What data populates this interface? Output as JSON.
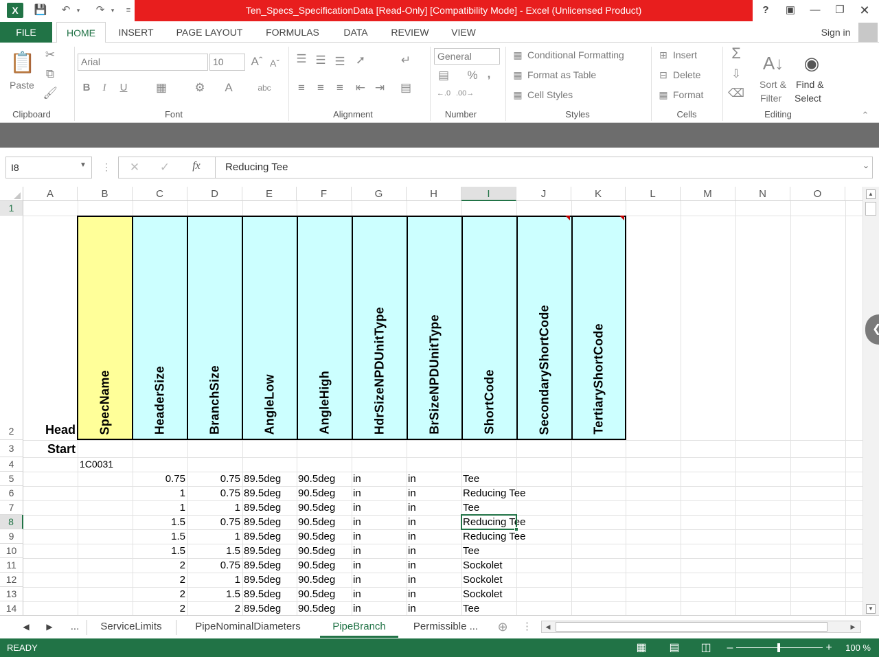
{
  "app": {
    "title": "Ten_Specs_SpecificationData  [Read-Only]  [Compatibility Mode] -  Excel (Unlicensed Product)",
    "sign_in": "Sign in",
    "help": "?"
  },
  "tabs": [
    "FILE",
    "HOME",
    "INSERT",
    "PAGE LAYOUT",
    "FORMULAS",
    "DATA",
    "REVIEW",
    "VIEW"
  ],
  "ribbon": {
    "clipboard": {
      "paste": "Paste",
      "label": "Clipboard"
    },
    "font": {
      "name": "Arial",
      "size": "10",
      "label": "Font",
      "bold": "B",
      "italic": "I",
      "underline": "U"
    },
    "alignment": {
      "label": "Alignment"
    },
    "number": {
      "format": "General",
      "percent": "%",
      "comma": ",",
      "label": "Number"
    },
    "styles": {
      "conditional": "Conditional Formatting",
      "table": "Format as Table",
      "cell": "Cell Styles",
      "label": "Styles"
    },
    "cells": {
      "insert": "Insert",
      "delete": "Delete",
      "format": "Format",
      "label": "Cells"
    },
    "editing": {
      "sort1": "Sort &",
      "sort2": "Filter",
      "find1": "Find &",
      "find2": "Select",
      "label": "Editing"
    }
  },
  "formula_bar": {
    "name_box": "I8",
    "fx": "fx",
    "value": "Reducing Tee"
  },
  "columns": [
    "A",
    "B",
    "C",
    "D",
    "E",
    "F",
    "G",
    "H",
    "I",
    "J",
    "K",
    "L",
    "M",
    "N",
    "O"
  ],
  "rows": [
    "1",
    "2",
    "3",
    "4",
    "5",
    "6",
    "7",
    "8",
    "9",
    "10",
    "11",
    "12",
    "13",
    "14"
  ],
  "headers": [
    "SpecName",
    "HeaderSize",
    "BranchSize",
    "AngleLow",
    "AngleHigh",
    "HdrSizeNPDUnitType",
    "BrSizeNPDUnitType",
    "ShortCode",
    "SecondaryShortCode",
    "TertiaryShortCode"
  ],
  "a_labels": {
    "row2": "Head",
    "row3": "Start"
  },
  "spec_value": "1C0031",
  "data_rows": [
    {
      "c": "0.75",
      "d": "0.75",
      "e": "89.5deg",
      "f": "90.5deg",
      "g": "in",
      "h": "in",
      "i": "Tee"
    },
    {
      "c": "1",
      "d": "0.75",
      "e": "89.5deg",
      "f": "90.5deg",
      "g": "in",
      "h": "in",
      "i": "Reducing Tee"
    },
    {
      "c": "1",
      "d": "1",
      "e": "89.5deg",
      "f": "90.5deg",
      "g": "in",
      "h": "in",
      "i": "Tee"
    },
    {
      "c": "1.5",
      "d": "0.75",
      "e": "89.5deg",
      "f": "90.5deg",
      "g": "in",
      "h": "in",
      "i": "Reducing Tee"
    },
    {
      "c": "1.5",
      "d": "1",
      "e": "89.5deg",
      "f": "90.5deg",
      "g": "in",
      "h": "in",
      "i": "Reducing Tee"
    },
    {
      "c": "1.5",
      "d": "1.5",
      "e": "89.5deg",
      "f": "90.5deg",
      "g": "in",
      "h": "in",
      "i": "Tee"
    },
    {
      "c": "2",
      "d": "0.75",
      "e": "89.5deg",
      "f": "90.5deg",
      "g": "in",
      "h": "in",
      "i": "Sockolet"
    },
    {
      "c": "2",
      "d": "1",
      "e": "89.5deg",
      "f": "90.5deg",
      "g": "in",
      "h": "in",
      "i": "Sockolet"
    },
    {
      "c": "2",
      "d": "1.5",
      "e": "89.5deg",
      "f": "90.5deg",
      "g": "in",
      "h": "in",
      "i": "Sockolet"
    },
    {
      "c": "2",
      "d": "2",
      "e": "89.5deg",
      "f": "90.5deg",
      "g": "in",
      "h": "in",
      "i": "Tee"
    }
  ],
  "sheet_tabs": {
    "more": "...",
    "tabs": [
      "ServiceLimits",
      "PipeNominalDiameters",
      "PipeBranch",
      "Permissible ..."
    ],
    "active": "PipeBranch"
  },
  "status": {
    "mode": "READY",
    "zoom": "100 %"
  },
  "colors": {
    "excel_green": "#217346",
    "title_red": "#e81e1e",
    "spec_fill": "#ffff99",
    "header_fill": "#ccffff"
  }
}
